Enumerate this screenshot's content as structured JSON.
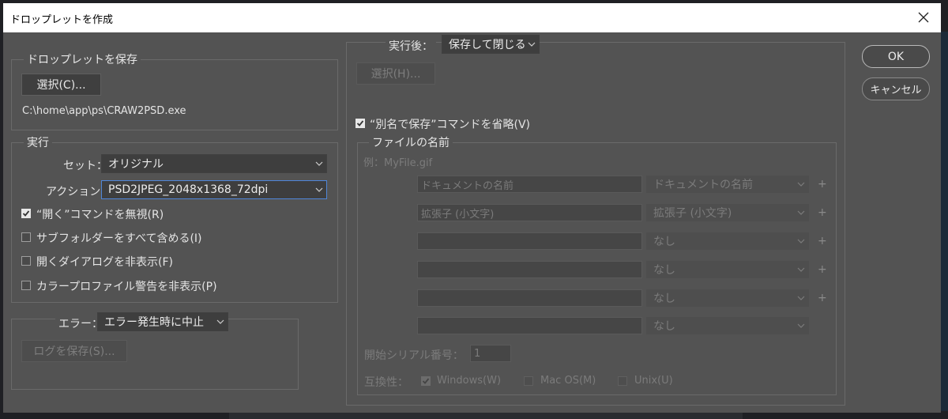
{
  "window": {
    "title": "ドロップレットを作成"
  },
  "buttons": {
    "ok": "OK",
    "cancel": "キャンセル"
  },
  "save_droplet": {
    "legend": "ドロップレットを保存",
    "select_button": "選択(C)...",
    "path": "C:\\home\\app\\ps\\CRAW2PSD.exe"
  },
  "play": {
    "legend": "実行",
    "set_label": "セット：",
    "set_value": "オリジナル",
    "action_label": "アクション：",
    "action_value": "PSD2JPEG_2048x1368_72dpi",
    "options": [
      {
        "label": "“開く”コマンドを無視(R)",
        "checked": true
      },
      {
        "label": "サブフォルダーをすべて含める(I)",
        "checked": false
      },
      {
        "label": "開くダイアログを非表示(F)",
        "checked": false
      },
      {
        "label": "カラープロファイル警告を非表示(P)",
        "checked": false
      }
    ]
  },
  "errors": {
    "label": "エラー：",
    "value": "エラー発生時に中止",
    "save_log_button": "ログを保存(S)..."
  },
  "destination": {
    "label": "実行後：",
    "value": "保存して閉じる",
    "choose_button": "選択(H)...",
    "override_save_as": {
      "label": "“別名で保存”コマンドを省略(V)",
      "checked": true
    }
  },
  "file_naming": {
    "legend": "ファイルの名前",
    "example": "例：MyFile.gif",
    "rows": [
      {
        "text": "ドキュメントの名前",
        "select": "ドキュメントの名前",
        "plus": "+"
      },
      {
        "text": "拡張子 (小文字)",
        "select": "拡張子 (小文字)",
        "plus": "+"
      },
      {
        "text": "",
        "select": "なし",
        "plus": "+"
      },
      {
        "text": "",
        "select": "なし",
        "plus": "+"
      },
      {
        "text": "",
        "select": "なし",
        "plus": "+"
      },
      {
        "text": "",
        "select": "なし",
        "plus": ""
      }
    ],
    "starting_serial_label": "開始シリアル番号：",
    "starting_serial_value": "1",
    "compatibility_label": "互換性：",
    "compat": [
      {
        "label": "Windows(W)",
        "checked": true
      },
      {
        "label": "Mac OS(M)",
        "checked": false
      },
      {
        "label": "Unix(U)",
        "checked": false
      }
    ]
  },
  "colors": {
    "dialog_bg": "#535353",
    "field_bg": "#3e3e3e",
    "focus_border": "#4f86d8"
  }
}
